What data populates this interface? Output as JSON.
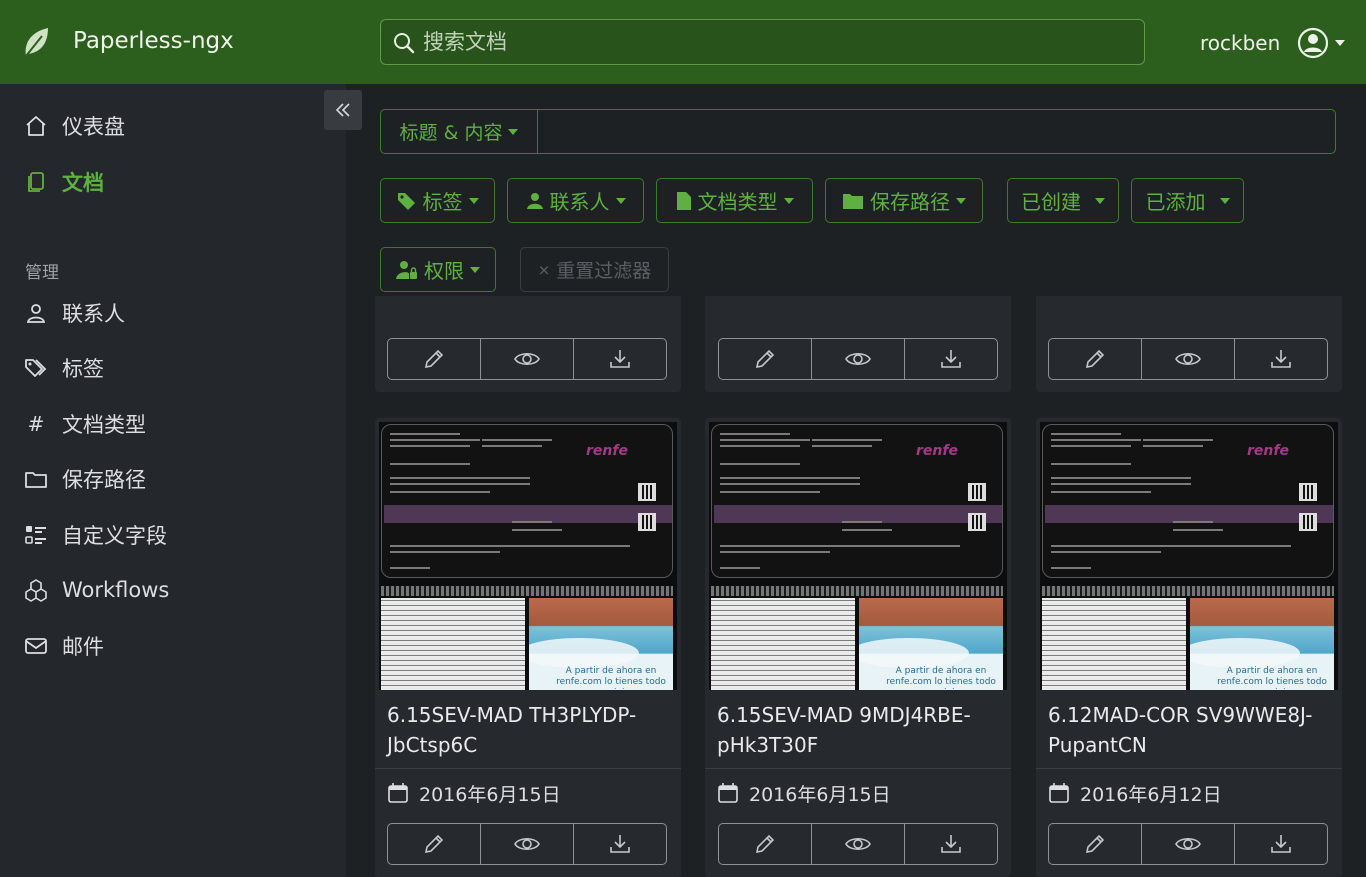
{
  "app": {
    "name": "Paperless-ngx"
  },
  "search": {
    "placeholder": "搜索文档"
  },
  "user": {
    "name": "rockben"
  },
  "sidebar": {
    "items": [
      {
        "label": "仪表盘",
        "icon": "house-icon"
      },
      {
        "label": "文档",
        "icon": "documents-icon",
        "active": true
      }
    ],
    "section_label": "管理",
    "manage_items": [
      {
        "label": "联系人",
        "icon": "person-icon"
      },
      {
        "label": "标签",
        "icon": "tags-icon"
      },
      {
        "label": "文档类型",
        "icon": "hash-icon"
      },
      {
        "label": "保存路径",
        "icon": "folder-icon"
      },
      {
        "label": "自定义字段",
        "icon": "ui-checks-icon"
      },
      {
        "label": "Workflows",
        "icon": "boxes-icon"
      },
      {
        "label": "邮件",
        "icon": "envelope-icon"
      }
    ]
  },
  "filters": {
    "text_mode": "标题 & 内容",
    "text_value": "",
    "buttons": [
      {
        "label": "标签",
        "icon": "tag-icon"
      },
      {
        "label": "联系人",
        "icon": "person-icon"
      },
      {
        "label": "文档类型",
        "icon": "file-icon"
      },
      {
        "label": "保存路径",
        "icon": "folder-icon"
      },
      {
        "label": "已创建",
        "icon": ""
      },
      {
        "label": "已添加",
        "icon": ""
      },
      {
        "label": "权限",
        "icon": "person-lock-icon"
      }
    ],
    "reset": "重置过滤器"
  },
  "cards": [
    {
      "title": "6.15SEV-MAD TH3PLYDP-JbCtsp6C",
      "date": "2016年6月15日"
    },
    {
      "title": "6.15SEV-MAD 9MDJ4RBE-pHk3T30F",
      "date": "2016年6月15日"
    },
    {
      "title": "6.12MAD-COR SV9WWE8J-PupantCN",
      "date": "2016年6月12日"
    }
  ],
  "thumbnail": {
    "brand": "renfe",
    "ad_text": "A partir de ahora en renfe.com lo tienes todo para viajar,"
  },
  "colors": {
    "topbar": "#2c5f1d",
    "accent": "#5fb040",
    "sidebar": "#24272b",
    "background": "#1e2124"
  }
}
